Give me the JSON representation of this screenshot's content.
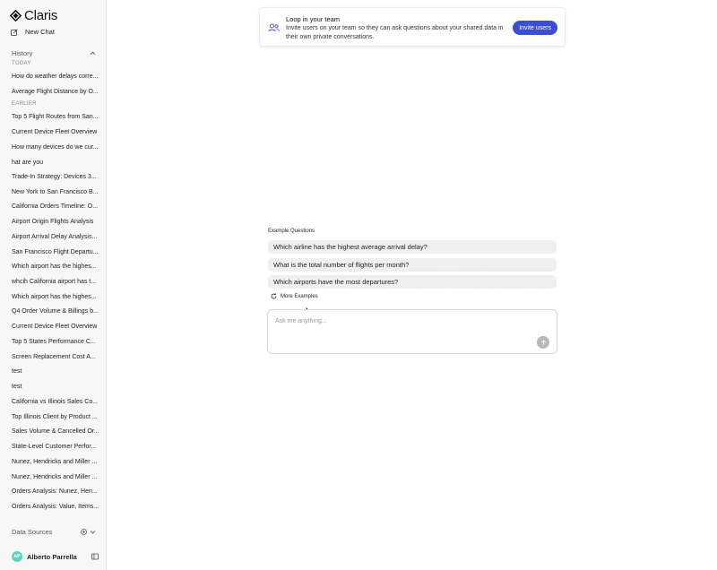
{
  "app": {
    "name": "Claris"
  },
  "sidebar": {
    "new_chat": "New Chat",
    "history_label": "History",
    "groups": [
      {
        "label": "TODAY",
        "items": [
          "How do weather delays corre...",
          "Average Flight Distance by O..."
        ]
      },
      {
        "label": "EARLIER",
        "items": [
          "Top 5 Flight Routes from San...",
          "Current Device Fleet Overview",
          "How many devices do we cur...",
          "hat are you",
          "Trade-In Strategy: Devices 3...",
          "New York to San Francisco B...",
          "California Orders Timeline: O...",
          "Airport Origin Flights Analysis",
          "Airport Arrival Delay Analysis...",
          "San Francisco Flight Departu...",
          "Which airport has the highes...",
          "whcih California airport has t...",
          "Which airport has the highes...",
          "Q4 Order Volume & Billings b...",
          "Current Device Fleet Overview",
          "Top 5 States Performance C...",
          "Screen Replacement Cost A...",
          "test",
          "test",
          "California vs Illinois Sales Co...",
          "Top Illinois Client by Product ...",
          "Sales Volume & Cancelled Or...",
          "State-Level Customer Perfor...",
          "Nunez, Hendricks and Miller ...",
          "Nunez, Hendricks and Miller ...",
          "Orders Analysis: Nunez, Hen...",
          "Orders Analysis: Value, Items..."
        ]
      }
    ],
    "data_sources_label": "Data Sources",
    "user": {
      "initials": "AP",
      "name": "Alberto Parrella"
    }
  },
  "banner": {
    "title": "Loop in your team",
    "description": "Invite users on your team so they can ask questions about your shared data in their own private conversations.",
    "button": "Invite users"
  },
  "main": {
    "examples_label": "Example Questions",
    "questions": [
      "Which airline has the highest average arrival delay?",
      "What is the total number of flights per month?",
      "Which airports have the most departures?"
    ],
    "more_examples": "More Examples",
    "input_placeholder": "Ask me anything..."
  },
  "colors": {
    "accent": "#3d4ed6",
    "avatar": "#5fd3c0",
    "send": "#b7b7b7"
  }
}
